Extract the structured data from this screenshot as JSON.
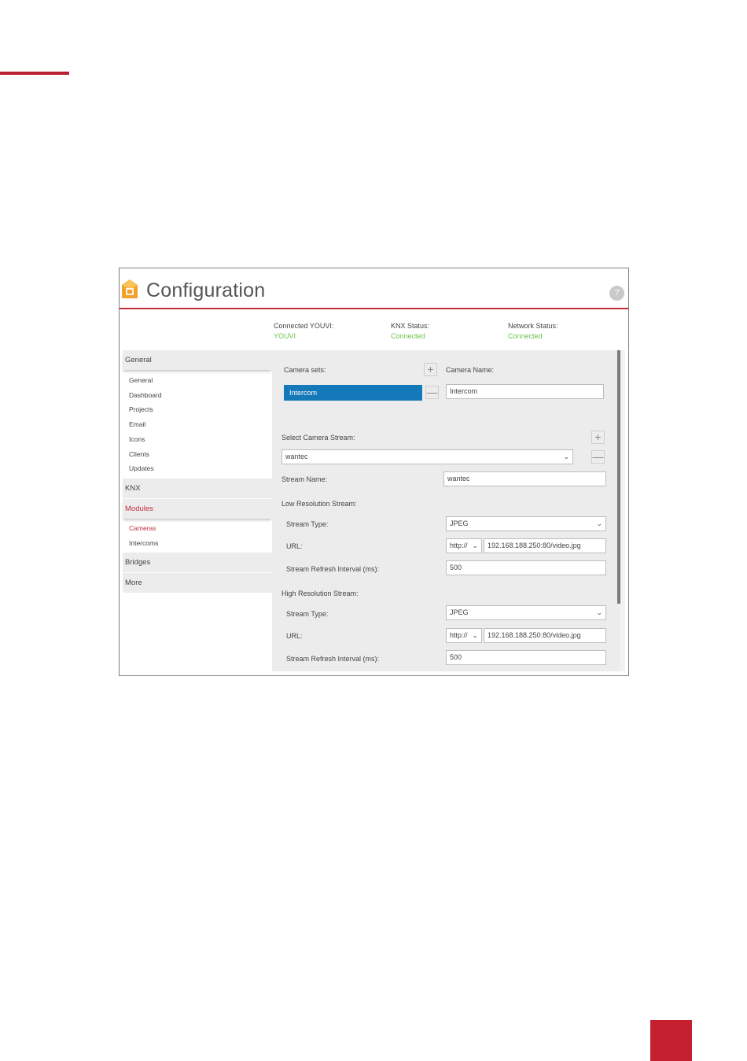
{
  "header": {
    "title": "Configuration"
  },
  "status": {
    "youvi": {
      "label": "Connected YOUVI:",
      "value": "YOUVI"
    },
    "knx": {
      "label": "KNX Status:",
      "value": "Connected"
    },
    "network": {
      "label": "Network Status:",
      "value": "Connected"
    }
  },
  "sidebar": {
    "general": {
      "label": "General",
      "items": [
        "General",
        "Dashboard",
        "Projects",
        "Email",
        "Icons",
        "Clients",
        "Updates"
      ]
    },
    "knx": {
      "label": "KNX"
    },
    "modules": {
      "label": "Modules",
      "items": [
        "Cameras",
        "Intercoms"
      ]
    },
    "bridges": {
      "label": "Bridges"
    },
    "more": {
      "label": "More"
    }
  },
  "cameras": {
    "camera_sets_label": "Camera sets:",
    "camera_name_label": "Camera Name:",
    "camera_set_selected": "Intercom",
    "camera_name_value": "Intercom",
    "select_stream_label": "Select Camera Stream:",
    "selected_stream": "wantec",
    "stream_name_label": "Stream Name:",
    "stream_name_value": "wantec",
    "low_res": {
      "title": "Low Resolution Stream:",
      "type_label": "Stream Type:",
      "type_value": "JPEG",
      "url_label": "URL:",
      "protocol": "http://",
      "url_value": "192.168.188.250:80/video.jpg",
      "refresh_label": "Stream Refresh Interval (ms):",
      "refresh_value": "500"
    },
    "high_res": {
      "title": "High Resolution Stream:",
      "type_label": "Stream Type:",
      "type_value": "JPEG",
      "url_label": "URL:",
      "protocol": "http://",
      "url_value": "192.168.188.250:80/video.jpg",
      "refresh_label": "Stream Refresh Interval (ms):",
      "refresh_value": "500"
    }
  },
  "icons": {
    "add": "+",
    "remove": "—",
    "chevron": "⌄",
    "help": "?"
  },
  "colors": {
    "accent": "#c0303c",
    "connected": "#6cc24a",
    "selected": "#1479b8",
    "page_mark": "#c4202f"
  }
}
